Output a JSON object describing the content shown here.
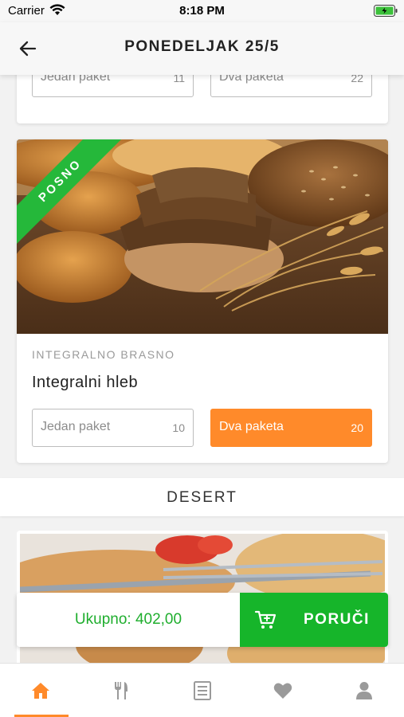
{
  "status_bar": {
    "carrier": "Carrier",
    "time": "8:18 PM"
  },
  "header": {
    "title": "PONEDELJAK 25/5",
    "back_icon": "arrow-left-icon"
  },
  "prev_card": {
    "option1": {
      "label": "Jedan paket",
      "price": "11"
    },
    "option2": {
      "label": "Dva paketa",
      "price": "22"
    }
  },
  "product": {
    "badge": "POSNO",
    "category": "INTEGRALNO BRASNO",
    "name": "Integralni hleb",
    "option1": {
      "label": "Jedan paket",
      "price": "10"
    },
    "option2": {
      "label": "Dva paketa",
      "price": "20",
      "selected": true
    }
  },
  "section": {
    "title": "DESERT"
  },
  "order_bar": {
    "total": "Ukupno: 402,00",
    "button_label": "PORUČI",
    "button_icon": "cart-add-icon"
  },
  "tabs": [
    {
      "icon": "home-icon",
      "active": true
    },
    {
      "icon": "fork-knife-icon",
      "active": false
    },
    {
      "icon": "menu-list-icon",
      "active": false
    },
    {
      "icon": "heart-icon",
      "active": false
    },
    {
      "icon": "user-icon",
      "active": false
    }
  ],
  "colors": {
    "accent": "#ff8a2a",
    "green": "#16b52a",
    "badge": "#25b83a"
  }
}
